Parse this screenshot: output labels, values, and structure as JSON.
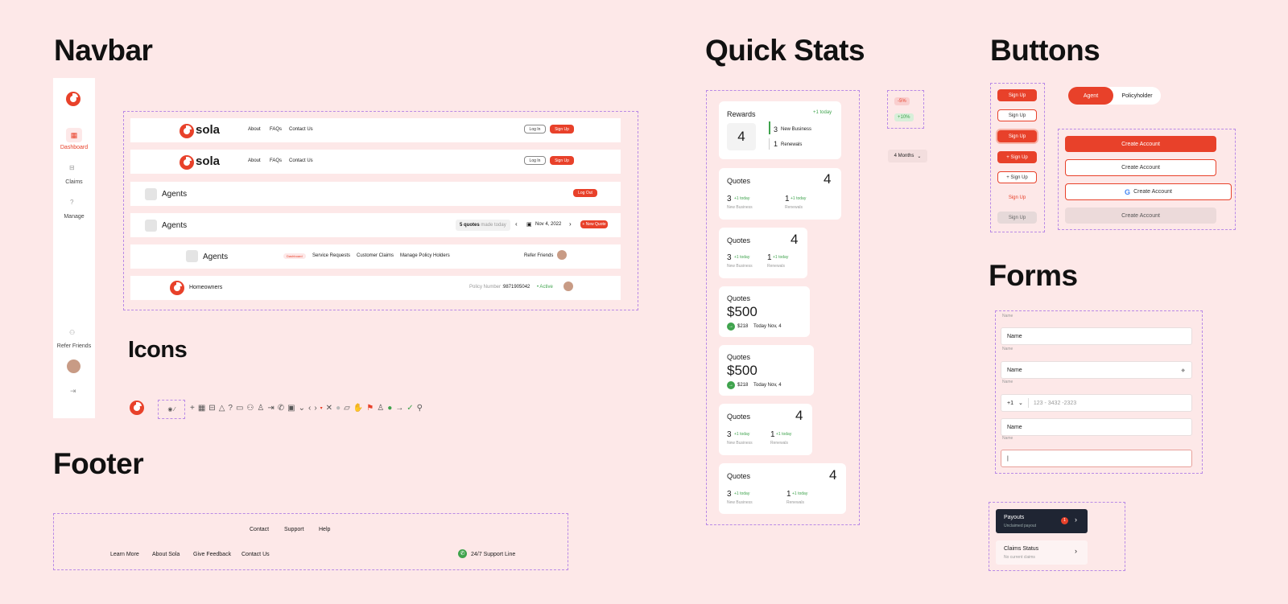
{
  "sections": {
    "navbar": "Navbar",
    "icons": "Icons",
    "footer": "Footer",
    "quick_stats": "Quick Stats",
    "buttons": "Buttons",
    "forms": "Forms"
  },
  "sidebar": {
    "items": [
      {
        "label": "Dashboard",
        "icon": "grid-icon"
      },
      {
        "label": "Claims",
        "icon": "briefcase-icon"
      },
      {
        "label": "Manage",
        "icon": "help-icon"
      },
      {
        "label": "Refer Friends",
        "icon": "users-icon"
      }
    ]
  },
  "navbars": {
    "brand": "sola",
    "links": [
      "About",
      "FAQs",
      "Contact Us"
    ],
    "login": "Log In",
    "signup": "Sign Up",
    "agents": "Agents",
    "logout": "Log Out",
    "quotes_count": "5 quotes",
    "quotes_suffix": "made today",
    "date": "Nov 4, 2022",
    "new_quote": "+ New Quote",
    "agent_links": [
      "Dashboard",
      "Service Requests",
      "Customer Claims",
      "Manage Policy Holders"
    ],
    "refer": "Refer Friends",
    "homeowners": "Homeowners",
    "policy_label": "Policy Number :",
    "policy_number": "9871905042",
    "status": "• Active"
  },
  "footer": {
    "top_links": [
      "Contact",
      "Support",
      "Help"
    ],
    "bottom_links": [
      "Learn More",
      "About Sola",
      "Give Feedback",
      "Contact Us"
    ],
    "support": "24/7 Support Line"
  },
  "stats": {
    "rewards": {
      "title": "Rewards",
      "today": "+1 today",
      "value": "4",
      "new_n": "3",
      "new_label": "New Business",
      "ren_n": "1",
      "ren_label": "Renewals"
    },
    "quotes_title": "Quotes",
    "quotes_value": "4",
    "new_n": "3",
    "ren_n": "1",
    "plus_today": "+1 today",
    "new_label": "New Business",
    "ren_label": "Renewals",
    "money": "$500",
    "money_small": "$218",
    "money_date": "Today Nov, 4",
    "neg": "-5%",
    "pos": "+10%",
    "period": "4 Months"
  },
  "buttons": {
    "signup": "Sign Up",
    "plus_signup": "+ Sign Up",
    "agent": "Agent",
    "policyholder": "Policyholder",
    "create": "Create Account"
  },
  "forms": {
    "label": "Name",
    "value": "Name",
    "cc": "+1",
    "phone_placeholder": "123 - 3432 -2323",
    "cursor": "|"
  },
  "cards": [
    {
      "title": "Payouts",
      "sub": "Unclaimed payout",
      "badge": "1"
    },
    {
      "title": "Claims Status",
      "sub": "No current claims"
    }
  ]
}
